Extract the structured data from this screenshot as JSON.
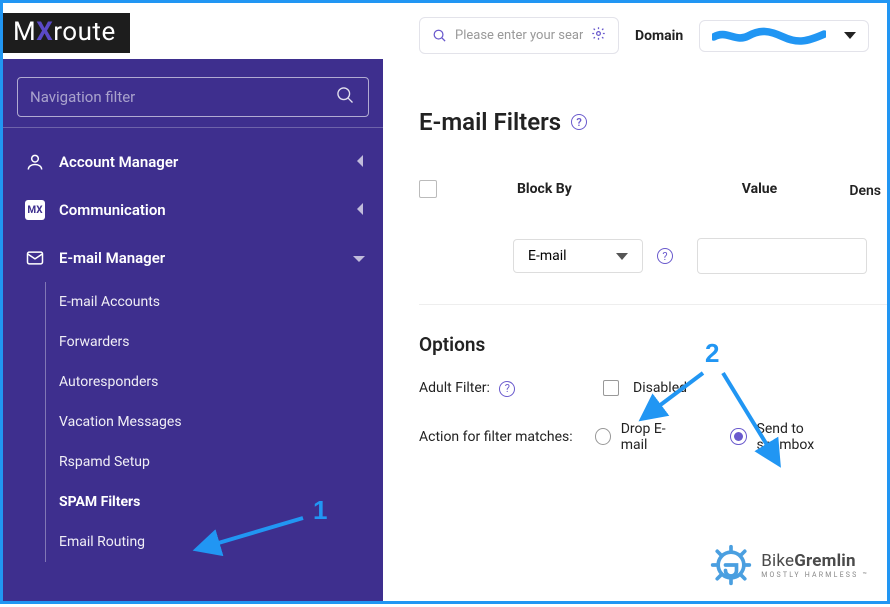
{
  "logo": {
    "part1": "M",
    "x": "X",
    "part2": "route"
  },
  "sidebar": {
    "filter_placeholder": "Navigation filter",
    "items": [
      {
        "label": "Account Manager",
        "icon": "user"
      },
      {
        "label": "Communication",
        "icon": "badge"
      },
      {
        "label": "E-mail Manager",
        "icon": "mail",
        "expanded": true
      }
    ],
    "sub_items": [
      {
        "label": "E-mail Accounts"
      },
      {
        "label": "Forwarders"
      },
      {
        "label": "Autoresponders"
      },
      {
        "label": "Vacation Messages"
      },
      {
        "label": "Rspamd Setup"
      },
      {
        "label": "SPAM Filters",
        "active": true
      },
      {
        "label": "Email Routing"
      }
    ]
  },
  "topbar": {
    "search_placeholder": "Please enter your search q",
    "domain_label": "Domain"
  },
  "page": {
    "title": "E-mail Filters",
    "density_label": "Dens",
    "columns": {
      "block_by": "Block By",
      "value": "Value"
    },
    "block_by_selected": "E-mail",
    "options_heading": "Options",
    "adult_filter_label": "Adult Filter:",
    "adult_filter_status": "Disabled",
    "action_label": "Action for filter matches:",
    "radio_drop": "Drop E-mail",
    "radio_spambox": "Send to spambox"
  },
  "annotations": {
    "one": "1",
    "two": "2"
  },
  "watermark": {
    "line1a": "Bike",
    "line1b": "Gremlin",
    "line2": "MOSTLY HARMLESS ™"
  }
}
